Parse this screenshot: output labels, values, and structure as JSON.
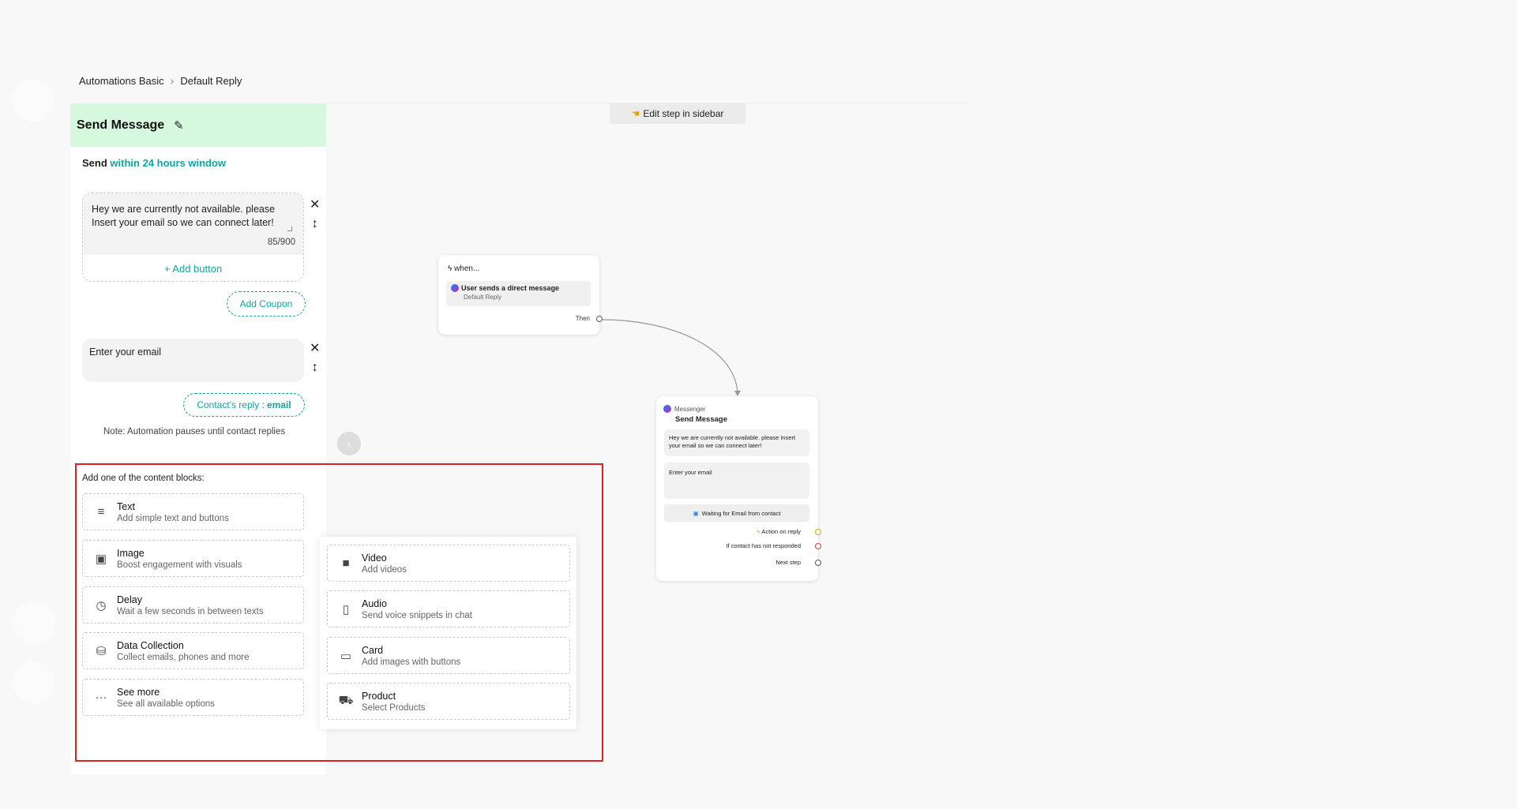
{
  "breadcrumb": {
    "root": "Automations Basic",
    "current": "Default Reply"
  },
  "canvas": {
    "edit_pill": "Edit step in sidebar"
  },
  "sidebar": {
    "title": "Send Message",
    "send_prefix": "Send",
    "send_window": "within 24 hours window",
    "message": {
      "text": "Hey we are currently not available. please Insert your email so we can connect later!",
      "counter": "85/900",
      "add_button": "+ Add button"
    },
    "add_coupon": "Add Coupon",
    "email_field": "Enter your email",
    "reply": {
      "prefix": "Contact's reply :",
      "value": "email"
    },
    "note": "Note: Automation pauses until contact replies",
    "blocks_title": "Add one of the content blocks:",
    "blocks": [
      {
        "title": "Text",
        "desc": "Add simple text and buttons",
        "icon": "lines-icon"
      },
      {
        "title": "Image",
        "desc": "Boost engagement with visuals",
        "icon": "image-icon"
      },
      {
        "title": "Delay",
        "desc": "Wait a few seconds in between texts",
        "icon": "clock-icon"
      },
      {
        "title": "Data Collection",
        "desc": "Collect emails, phones and more",
        "icon": "database-icon"
      },
      {
        "title": "See more",
        "desc": "See all available options",
        "icon": "ellipsis-icon"
      }
    ]
  },
  "popup": {
    "blocks": [
      {
        "title": "Video",
        "desc": "Add videos",
        "icon": "video-icon"
      },
      {
        "title": "Audio",
        "desc": "Send voice snippets in chat",
        "icon": "audio-file-icon"
      },
      {
        "title": "Card",
        "desc": "Add images with buttons",
        "icon": "card-icon"
      },
      {
        "title": "Product",
        "desc": "Select Products",
        "icon": "cart-icon"
      }
    ]
  },
  "trigger_node": {
    "when": "when...",
    "event": "User sends a direct message",
    "sub": "Default Reply",
    "then": "Then"
  },
  "message_node": {
    "channel": "Messenger",
    "title": "Send Message",
    "text": "Hey we are currently not available. please Insert your email so we can connect later!",
    "email": "Enter your email",
    "waiting": "Waiting for Email from contact",
    "action_on_reply": "Action on reply",
    "not_responded": "If contact has not responded",
    "next_step": "Next step"
  },
  "colors": {
    "accent": "#14a3a3",
    "header_bg": "#d5f8df",
    "highlight": "#e02020"
  }
}
